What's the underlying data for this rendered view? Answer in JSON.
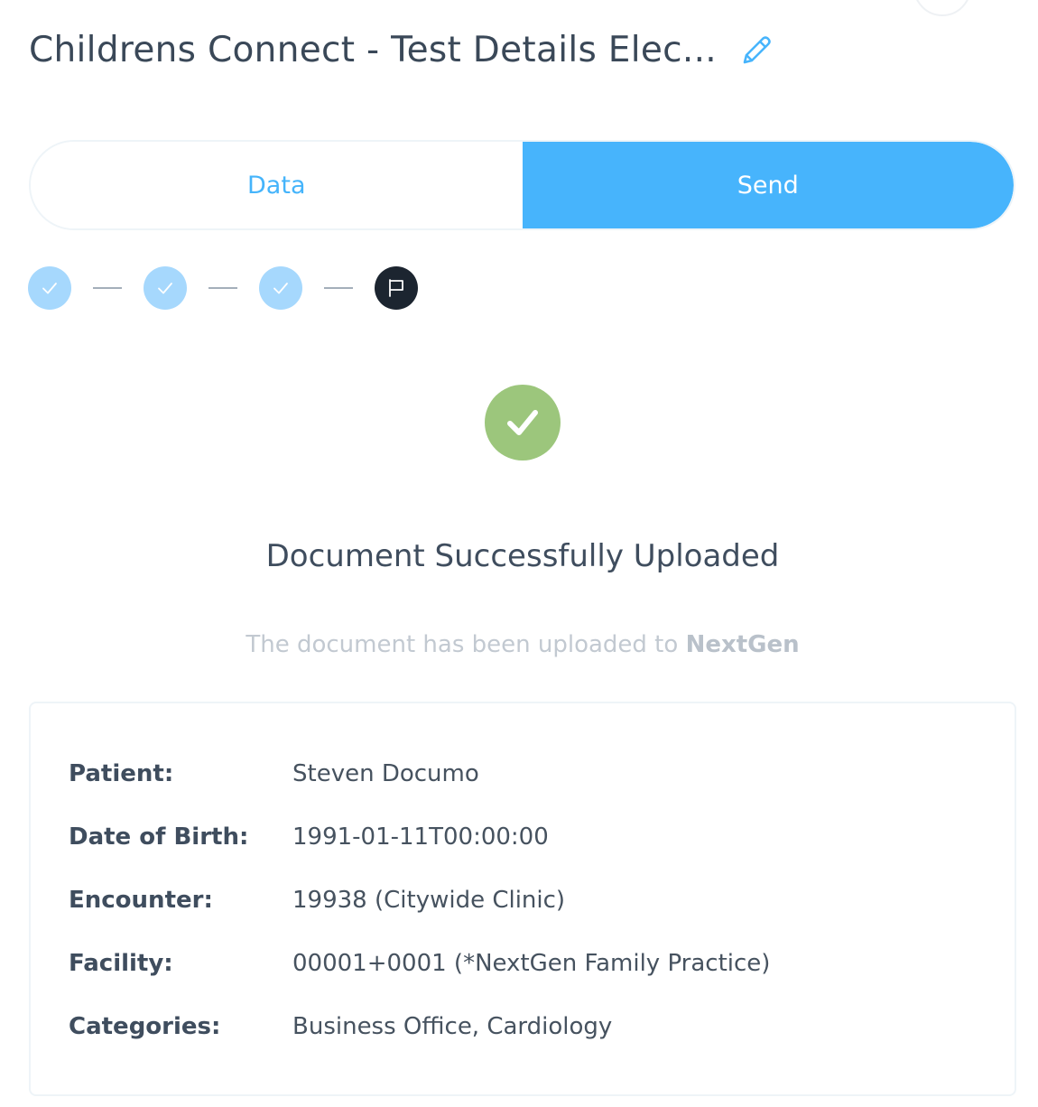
{
  "header": {
    "title": "Childrens Connect - Test Details Elec...",
    "edit_icon": "pencil-icon"
  },
  "tabs": [
    {
      "label": "Data",
      "active": false
    },
    {
      "label": "Send",
      "active": true
    }
  ],
  "stepper": {
    "steps": [
      {
        "state": "completed",
        "icon": "check-icon"
      },
      {
        "state": "completed",
        "icon": "check-icon"
      },
      {
        "state": "completed",
        "icon": "check-icon"
      },
      {
        "state": "current",
        "icon": "flag-icon"
      }
    ]
  },
  "status": {
    "icon": "success-check-icon",
    "heading": "Document Successfully Uploaded",
    "message_prefix": "The document has been uploaded to",
    "target_system": "NextGen"
  },
  "details": [
    {
      "label": "Patient:",
      "value": "Steven Documo"
    },
    {
      "label": "Date of Birth:",
      "value": "1991-01-11T00:00:00"
    },
    {
      "label": "Encounter:",
      "value": "19938 (Citywide Clinic)"
    },
    {
      "label": "Facility:",
      "value": "00001+0001 (*NextGen Family Practice)"
    },
    {
      "label": "Categories:",
      "value": "Business Office, Cardiology"
    }
  ],
  "colors": {
    "accent": "#47b4fc",
    "step_done": "#a6d8fd",
    "step_current": "#1c2530",
    "success": "#9cc67c"
  }
}
